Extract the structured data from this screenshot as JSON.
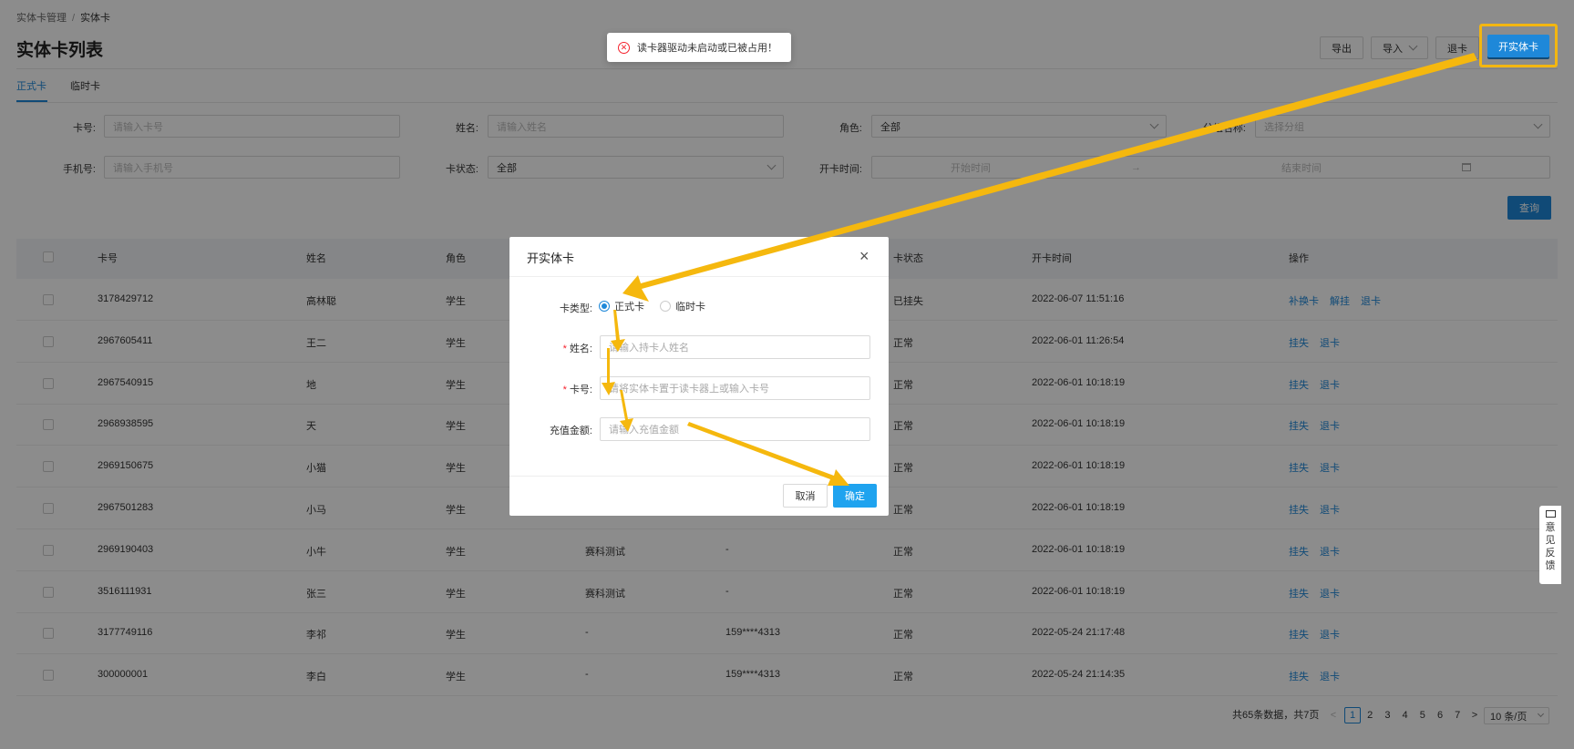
{
  "breadcrumb": {
    "parent": "实体卡管理",
    "sep": "/",
    "current": "实体卡"
  },
  "page_title": "实体卡列表",
  "toolbar": {
    "export": "导出",
    "import": "导入",
    "return_card": "退卡",
    "open_card": "开实体卡"
  },
  "tabs": [
    {
      "label": "正式卡",
      "active": true
    },
    {
      "label": "临时卡",
      "active": false
    }
  ],
  "filters": {
    "card_no": {
      "label": "卡号:",
      "placeholder": "请输入卡号"
    },
    "name": {
      "label": "姓名:",
      "placeholder": "请输入姓名"
    },
    "role": {
      "label": "角色:",
      "value": "全部"
    },
    "group": {
      "label": "分组名称:",
      "placeholder": "选择分组"
    },
    "phone": {
      "label": "手机号:",
      "placeholder": "请输入手机号"
    },
    "status": {
      "label": "卡状态:",
      "value": "全部"
    },
    "open_time": {
      "label": "开卡时间:",
      "start": "开始时间",
      "sep": "→",
      "end": "结束时间"
    },
    "query": "查询"
  },
  "table": {
    "columns": [
      "卡号",
      "姓名",
      "角色",
      "",
      "",
      "卡状态",
      "开卡时间",
      "操作"
    ],
    "rows": [
      {
        "card": "3178429712",
        "name": "高林聪",
        "role": "学生",
        "group": "",
        "phone": "",
        "status": "已挂失",
        "time": "2022-06-07 11:51:16",
        "actions": [
          "补换卡",
          "解挂",
          "退卡"
        ]
      },
      {
        "card": "2967605411",
        "name": "王二",
        "role": "学生",
        "group": "",
        "phone": "",
        "status": "正常",
        "time": "2022-06-01 11:26:54",
        "actions": [
          "挂失",
          "退卡"
        ]
      },
      {
        "card": "2967540915",
        "name": "地",
        "role": "学生",
        "group": "",
        "phone": "",
        "status": "正常",
        "time": "2022-06-01 10:18:19",
        "actions": [
          "挂失",
          "退卡"
        ]
      },
      {
        "card": "2968938595",
        "name": "天",
        "role": "学生",
        "group": "",
        "phone": "",
        "status": "正常",
        "time": "2022-06-01 10:18:19",
        "actions": [
          "挂失",
          "退卡"
        ]
      },
      {
        "card": "2969150675",
        "name": "小猫",
        "role": "学生",
        "group": "",
        "phone": "",
        "status": "正常",
        "time": "2022-06-01 10:18:19",
        "actions": [
          "挂失",
          "退卡"
        ]
      },
      {
        "card": "2967501283",
        "name": "小马",
        "role": "学生",
        "group": "",
        "phone": "",
        "status": "正常",
        "time": "2022-06-01 10:18:19",
        "actions": [
          "挂失",
          "退卡"
        ]
      },
      {
        "card": "2969190403",
        "name": "小牛",
        "role": "学生",
        "group": "赛科测试",
        "phone": "-",
        "status": "正常",
        "time": "2022-06-01 10:18:19",
        "actions": [
          "挂失",
          "退卡"
        ]
      },
      {
        "card": "3516111931",
        "name": "张三",
        "role": "学生",
        "group": "赛科测试",
        "phone": "-",
        "status": "正常",
        "time": "2022-06-01 10:18:19",
        "actions": [
          "挂失",
          "退卡"
        ]
      },
      {
        "card": "3177749116",
        "name": "李祁",
        "role": "学生",
        "group": "-",
        "phone": "159****4313",
        "status": "正常",
        "time": "2022-05-24 21:17:48",
        "actions": [
          "挂失",
          "退卡"
        ]
      },
      {
        "card": "300000001",
        "name": "李白",
        "role": "学生",
        "group": "-",
        "phone": "159****4313",
        "status": "正常",
        "time": "2022-05-24 21:14:35",
        "actions": [
          "挂失",
          "退卡"
        ]
      }
    ]
  },
  "pagination": {
    "summary": "共65条数据，共7页",
    "prev": "<",
    "pages": [
      "1",
      "2",
      "3",
      "4",
      "5",
      "6",
      "7"
    ],
    "current": "1",
    "next": ">",
    "page_size": "10 条/页"
  },
  "toast": {
    "icon": "error-circle-icon",
    "message": "读卡器驱动未启动或已被占用！"
  },
  "modal": {
    "title": "开实体卡",
    "close": "×",
    "card_type": {
      "label": "卡类型:",
      "options": [
        "正式卡",
        "临时卡"
      ],
      "selected": "正式卡"
    },
    "name": {
      "label": "姓名:",
      "placeholder": "请输入持卡人姓名"
    },
    "card_no": {
      "label": "卡号:",
      "placeholder": "请将实体卡置于读卡器上或输入卡号"
    },
    "amount": {
      "label": "充值金额:",
      "placeholder": "请输入充值金额"
    },
    "required_mark": "*",
    "cancel": "取消",
    "confirm": "确定"
  },
  "feedback": {
    "chars": [
      "意",
      "见",
      "反",
      "馈"
    ]
  },
  "colors": {
    "accent": "#1e88d9",
    "annotation": "#f3b610",
    "error": "#f5222d"
  }
}
